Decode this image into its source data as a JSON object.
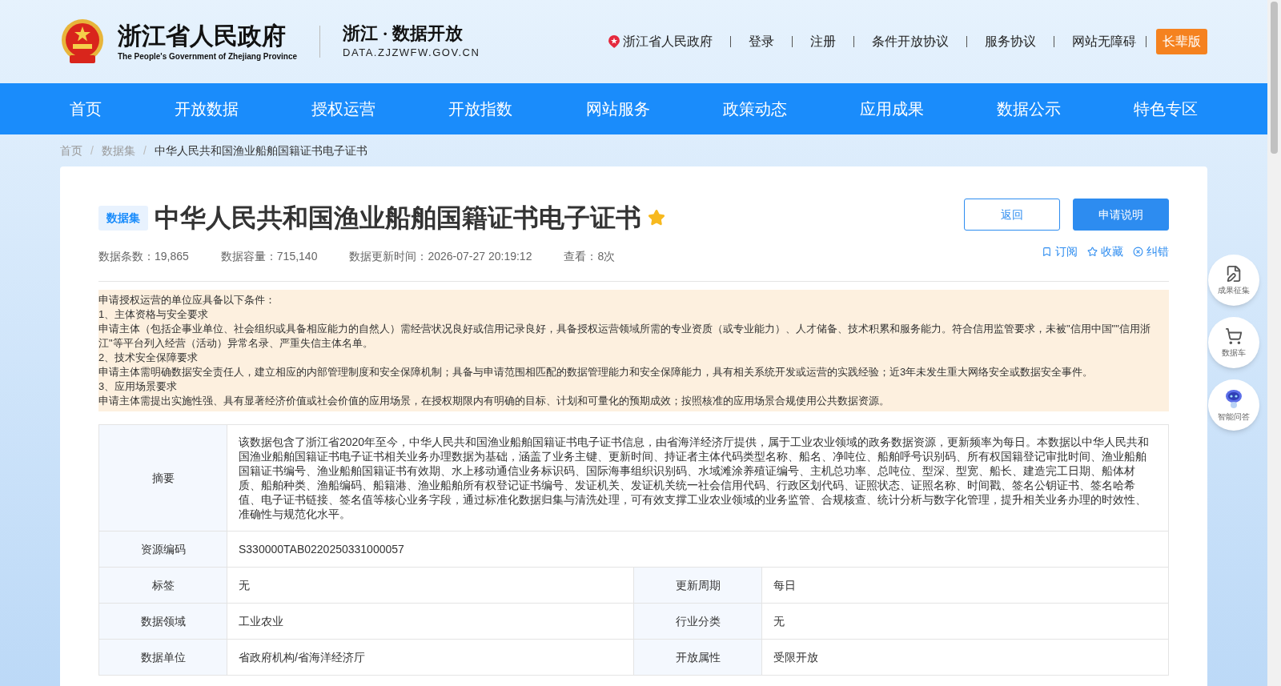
{
  "header": {
    "site_title": "浙江省人民政府",
    "site_subtitle": "The People's Government of Zhejiang Province",
    "portal_title": "浙江 · 数据开放",
    "portal_domain": "DATA.ZJZWFW.GOV.CN",
    "links": [
      "浙江省人民政府",
      "登录",
      "注册",
      "条件开放协议",
      "服务协议",
      "网站无障碍"
    ],
    "elder_button": "长辈版"
  },
  "nav": [
    "首页",
    "开放数据",
    "授权运营",
    "开放指数",
    "网站服务",
    "政策动态",
    "应用成果",
    "数据公示",
    "特色专区"
  ],
  "breadcrumb": {
    "separator": "/",
    "items": [
      "首页",
      "数据集",
      "中华人民共和国渔业船舶国籍证书电子证书"
    ]
  },
  "dataset": {
    "tag": "数据集",
    "title": "中华人民共和国渔业船舶国籍证书电子证书",
    "meta": [
      "数据条数：19,865",
      "数据容量：715,140",
      "数据更新时间：2026-07-27 20:19:12",
      "查看：8次"
    ],
    "buttons": [
      {
        "label": "返回",
        "kind": "outline"
      },
      {
        "label": "申请说明",
        "kind": "primary"
      }
    ],
    "actions": [
      {
        "label": "订阅",
        "kind": "subscribe"
      },
      {
        "label": "收藏",
        "kind": "favorite"
      },
      {
        "label": "纠错",
        "kind": "report"
      }
    ],
    "notice": [
      "申请授权运营的单位应具备以下条件：",
      "1、主体资格与安全要求",
      "申请主体（包括企事业单位、社会组织或具备相应能力的自然人）需经营状况良好或信用记录良好，具备授权运营领域所需的专业资质（或专业能力）、人才储备、技术积累和服务能力。符合信用监管要求，未被\"信用中国\"\"信用浙江\"等平台列入经营（活动）异常名录、严重失信主体名单。",
      "2、技术安全保障要求",
      "申请主体需明确数据安全责任人，建立相应的内部管理制度和安全保障机制；具备与申请范围相匹配的数据管理能力和安全保障能力，具有相关系统开发或运营的实践经验；近3年未发生重大网络安全或数据安全事件。",
      "3、应用场景要求",
      "申请主体需提出实施性强、具有显著经济价值或社会价值的应用场景，在授权期限内有明确的目标、计划和可量化的预期成效；按照核准的应用场景合规使用公共数据资源。"
    ],
    "details": [
      {
        "cells": [
          {
            "label": "摘要",
            "value": "该数据包含了浙江省2020年至今，中华人民共和国渔业船舶国籍证书电子证书信息，由省海洋经济厅提供，属于工业农业领域的政务数据资源，更新频率为每日。本数据以中华人民共和国渔业船舶国籍证书电子证书相关业务办理数据为基础，涵盖了业务主键、更新时间、持证者主体代码类型名称、船名、净吨位、船舶呼号识别码、所有权国籍登记审批时间、渔业船舶国籍证书编号、渔业船舶国籍证书有效期、水上移动通信业务标识码、国际海事组织识别码、水域滩涂养殖证编号、主机总功率、总吨位、型深、型宽、船长、建造完工日期、船体材质、船舶种类、渔船编码、船籍港、渔业船舶所有权登记证书编号、发证机关、发证机关统一社会信用代码、行政区划代码、证照状态、证照名称、时间戳、签名公钥证书、签名哈希值、电子证书链接、签名值等核心业务字段，通过标准化数据归集与清洗处理，可有效支撑工业农业领域的业务监管、合规核查、统计分析与数字化管理，提升相关业务办理的时效性、准确性与规范化水平。"
          }
        ]
      },
      {
        "cells": [
          {
            "label": "资源编码",
            "value": "S330000TAB0220250331000057"
          }
        ]
      },
      {
        "cells": [
          {
            "label": "标签",
            "value": "无"
          },
          {
            "label": "更新周期",
            "value": "每日"
          }
        ]
      },
      {
        "cells": [
          {
            "label": "数据领域",
            "value": "工业农业"
          },
          {
            "label": "行业分类",
            "value": "无"
          }
        ]
      },
      {
        "cells": [
          {
            "label": "数据单位",
            "value": "省政府机构/省海洋经济厅"
          },
          {
            "label": "开放属性",
            "value": "受限开放"
          }
        ]
      }
    ]
  },
  "float_buttons": [
    {
      "label": "成果征集",
      "kind": "collect"
    },
    {
      "label": "数据车",
      "kind": "cart"
    },
    {
      "label": "智能问答",
      "kind": "robot"
    }
  ]
}
